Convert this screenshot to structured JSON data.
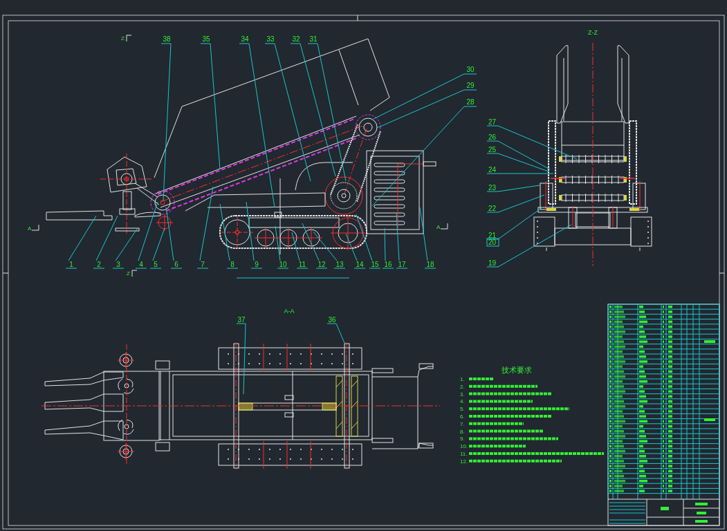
{
  "side_view": {
    "bottom_balloons": [
      "1",
      "2",
      "3",
      "4",
      "5",
      "6",
      "7",
      "8",
      "9",
      "10",
      "11",
      "12",
      "13",
      "14",
      "15",
      "16",
      "17",
      "18"
    ],
    "top_balloons": [
      "38",
      "35",
      "34",
      "33",
      "32",
      "31"
    ],
    "right_balloons": [
      "30",
      "29",
      "28"
    ],
    "section_marks": [
      {
        "kind": "z",
        "label": "Z"
      },
      {
        "kind": "z",
        "label": "Z"
      },
      {
        "kind": "a",
        "label": "A"
      },
      {
        "kind": "a",
        "label": "A"
      }
    ]
  },
  "section_zz": {
    "title": "Z-Z",
    "balloons": [
      "27",
      "26",
      "25",
      "24",
      "23",
      "22",
      "21",
      "20",
      "19"
    ]
  },
  "section_aa": {
    "title": "A-A",
    "balloons": [
      "37",
      "36"
    ]
  },
  "technical_requirements": {
    "title": "技术要求",
    "items": [
      "1.",
      "2.",
      "3.",
      "4.",
      "5.",
      "6.",
      "7.",
      "8.",
      "9.",
      "10.",
      "11.",
      "12."
    ]
  }
}
